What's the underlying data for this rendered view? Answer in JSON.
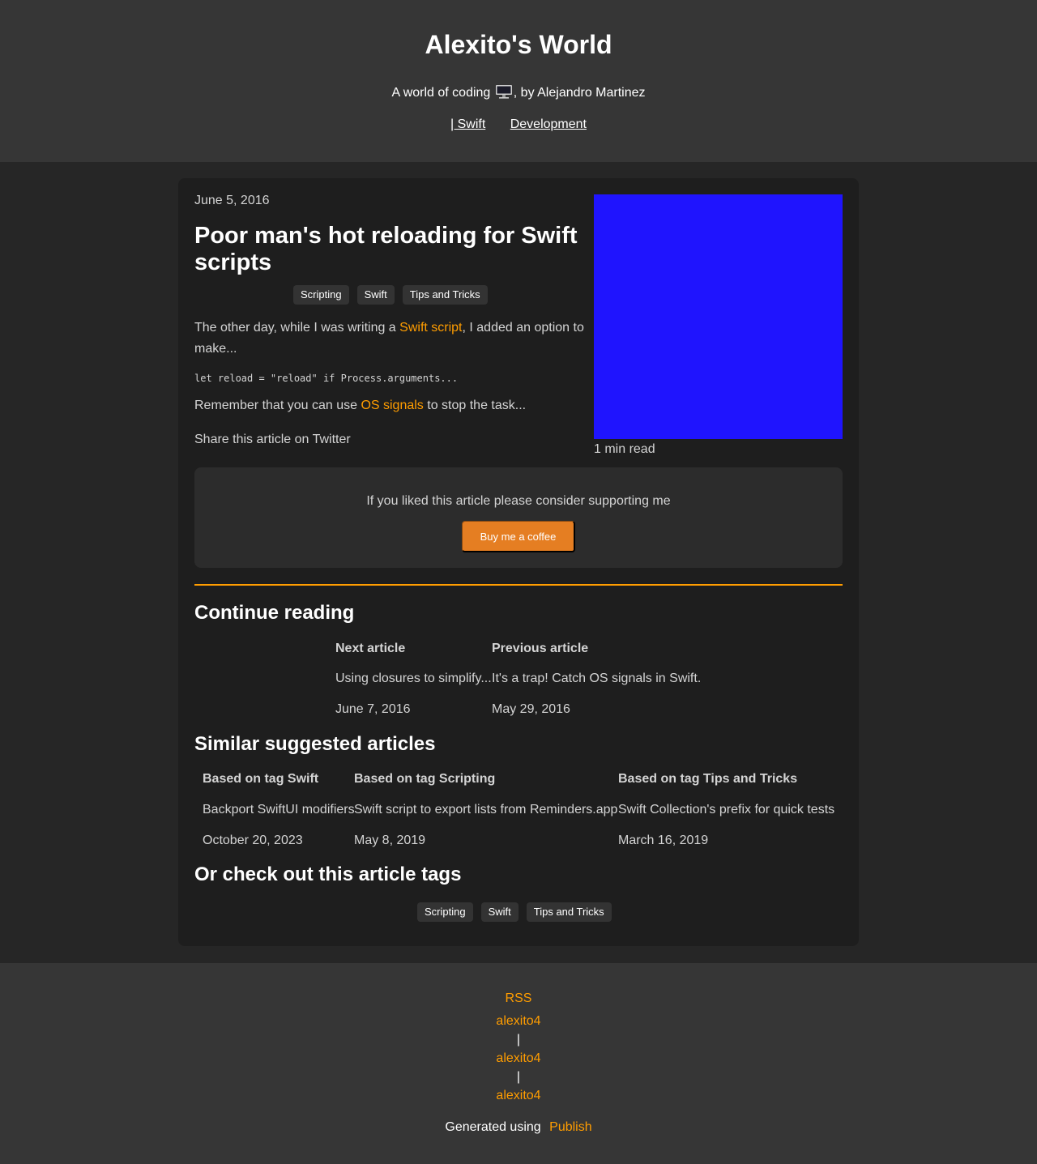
{
  "header": {
    "title": "Alexito's World",
    "subtitle_pre": "A world of coding",
    "subtitle_post": ", by Alejandro Martinez",
    "nav": [
      "| Swift",
      "Development"
    ]
  },
  "article": {
    "date": "June 5, 2016",
    "title": "Poor man's hot reloading for Swift scripts",
    "tags": [
      "Scripting",
      "Swift",
      "Tips and Tricks"
    ],
    "excerpt_pre": "The other day, while I was writing a ",
    "excerpt_link": "Swift script",
    "excerpt_post": ", I added an option to make...",
    "code": "let reload = \"reload\" if Process.arguments...",
    "remember_pre": "Remember that you can use ",
    "remember_link": "OS signals",
    "remember_post": " to stop the task...",
    "share": "Share this article on Twitter",
    "read_time": "1 min read",
    "hero_color": "#1f14fe"
  },
  "support": {
    "text": "If you liked this article please consider supporting me",
    "button": "Buy me a coffee"
  },
  "continue_reading": {
    "title": "Continue reading",
    "next": {
      "heading": "Next article",
      "title": "Using closures to simplify...",
      "date": "June 7, 2016"
    },
    "previous": {
      "heading": "Previous article",
      "title": "It's a trap! Catch OS signals in Swift.",
      "date": "May 29, 2016"
    }
  },
  "similar": {
    "title": "Similar suggested articles",
    "columns": [
      {
        "heading": "Based on tag Swift",
        "title": "Backport SwiftUI modifiers",
        "date": "October 20, 2023"
      },
      {
        "heading": "Based on tag Scripting",
        "title": "Swift script to export lists from Reminders.app",
        "date": "May 8, 2019"
      },
      {
        "heading": "Based on tag Tips and Tricks",
        "title": "Swift Collection's prefix for quick tests",
        "date": "March 16, 2019"
      }
    ]
  },
  "check_tags": {
    "title": "Or check out this article tags",
    "tags": [
      "Scripting",
      "Swift",
      "Tips and Tricks"
    ]
  },
  "footer": {
    "rss": "RSS",
    "links": [
      "alexito4",
      "alexito4",
      "alexito4"
    ],
    "separator": "|",
    "generated": "Generated using",
    "publish": "Publish"
  },
  "colors": {
    "accent": "#ff9d00",
    "header_bg": "#363636",
    "card_bg": "#1e1e1e",
    "button_bg": "#e57e22"
  }
}
